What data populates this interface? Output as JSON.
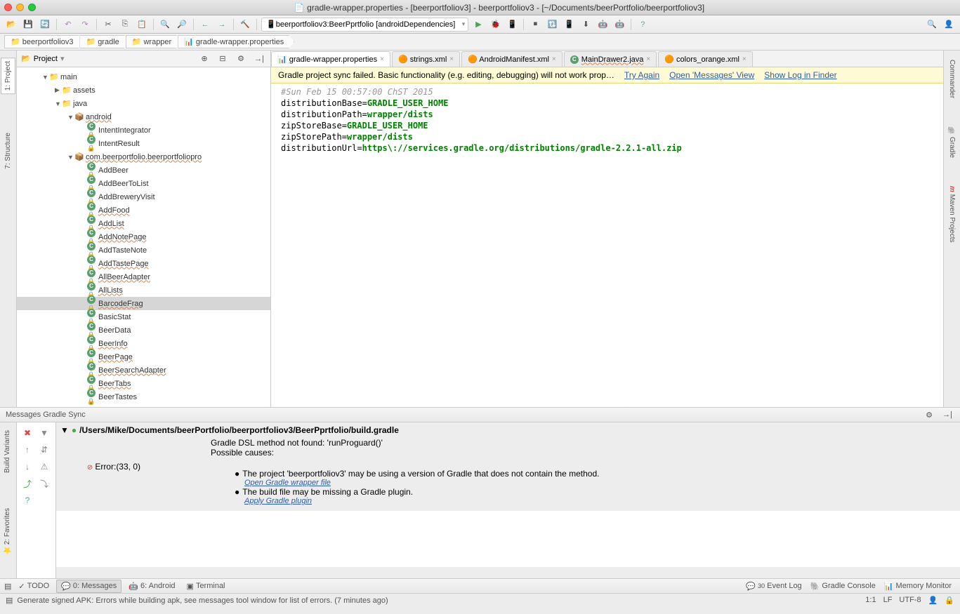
{
  "window": {
    "title": "gradle-wrapper.properties - [beerportfoliov3] - beerportfoliov3 - [~/Documents/beerPortfolio/beerportfoliov3]"
  },
  "toolbar": {
    "run_config": "beerportfoliov3:BeerPprtfolio [androidDependencies]"
  },
  "breadcrumbs": [
    "beerportfoliov3",
    "gradle",
    "wrapper",
    "gradle-wrapper.properties"
  ],
  "left_tabs": [
    "1: Project",
    "7: Structure"
  ],
  "right_tabs": [
    "Commander",
    "Gradle",
    "Maven Projects"
  ],
  "project_panel": {
    "title": "Project",
    "tree": [
      {
        "depth": 0,
        "arrow": "▼",
        "icon": "folder",
        "label": "main"
      },
      {
        "depth": 1,
        "arrow": "▶",
        "icon": "folder",
        "label": "assets"
      },
      {
        "depth": 1,
        "arrow": "▼",
        "icon": "folder",
        "label": "java"
      },
      {
        "depth": 2,
        "arrow": "▼",
        "icon": "pkg",
        "label": "android",
        "wavy": true
      },
      {
        "depth": 3,
        "arrow": "",
        "icon": "class",
        "label": "IntentIntegrator",
        "lock": true
      },
      {
        "depth": 3,
        "arrow": "",
        "icon": "class",
        "label": "IntentResult",
        "lock": true
      },
      {
        "depth": 2,
        "arrow": "▼",
        "icon": "pkg",
        "label": "com.beerportfolio.beerportfoliopro",
        "wavy": true
      },
      {
        "depth": 3,
        "arrow": "",
        "icon": "class",
        "label": "AddBeer",
        "lock": true
      },
      {
        "depth": 3,
        "arrow": "",
        "icon": "class",
        "label": "AddBeerToList",
        "lock": true
      },
      {
        "depth": 3,
        "arrow": "",
        "icon": "class",
        "label": "AddBreweryVisit",
        "lock": true
      },
      {
        "depth": 3,
        "arrow": "",
        "icon": "class",
        "label": "AddFood",
        "lock": true,
        "wavy": true
      },
      {
        "depth": 3,
        "arrow": "",
        "icon": "class",
        "label": "AddList",
        "lock": true,
        "wavy": true
      },
      {
        "depth": 3,
        "arrow": "",
        "icon": "class",
        "label": "AddNotePage",
        "lock": true,
        "wavy": true
      },
      {
        "depth": 3,
        "arrow": "",
        "icon": "class",
        "label": "AddTasteNote",
        "lock": true
      },
      {
        "depth": 3,
        "arrow": "",
        "icon": "class",
        "label": "AddTastePage",
        "lock": true,
        "wavy": true
      },
      {
        "depth": 3,
        "arrow": "",
        "icon": "class",
        "label": "AllBeerAdapter",
        "lock": true,
        "wavy": true
      },
      {
        "depth": 3,
        "arrow": "",
        "icon": "class",
        "label": "AllLists",
        "lock": true,
        "wavy": true
      },
      {
        "depth": 3,
        "arrow": "",
        "icon": "class",
        "label": "BarcodeFrag",
        "lock": true,
        "wavy": true,
        "selected": true
      },
      {
        "depth": 3,
        "arrow": "",
        "icon": "class",
        "label": "BasicStat",
        "lock": true
      },
      {
        "depth": 3,
        "arrow": "",
        "icon": "class",
        "label": "BeerData",
        "lock": true
      },
      {
        "depth": 3,
        "arrow": "",
        "icon": "class",
        "label": "BeerInfo",
        "lock": true,
        "wavy": true
      },
      {
        "depth": 3,
        "arrow": "",
        "icon": "class",
        "label": "BeerPage",
        "lock": true,
        "wavy": true
      },
      {
        "depth": 3,
        "arrow": "",
        "icon": "class",
        "label": "BeerSearchAdapter",
        "lock": true,
        "wavy": true
      },
      {
        "depth": 3,
        "arrow": "",
        "icon": "class",
        "label": "BeerTabs",
        "lock": true,
        "wavy": true
      },
      {
        "depth": 3,
        "arrow": "",
        "icon": "class",
        "label": "BeerTastes",
        "lock": true
      }
    ]
  },
  "editor_tabs": [
    {
      "label": "gradle-wrapper.properties",
      "active": true,
      "icon": "props"
    },
    {
      "label": "strings.xml",
      "icon": "xml"
    },
    {
      "label": "AndroidManifest.xml",
      "icon": "xml"
    },
    {
      "label": "MainDrawer2.java",
      "icon": "java",
      "wavy": true
    },
    {
      "label": "colors_orange.xml",
      "icon": "xml"
    }
  ],
  "sync_bar": {
    "msg": "Gradle project sync failed. Basic functionality (e.g. editing, debugging) will not work prop…",
    "try_again": "Try Again",
    "open_msgs": "Open 'Messages' View",
    "show_log": "Show Log in Finder"
  },
  "editor": {
    "comment": "#Sun Feb 15 00:57:00 ChST 2015",
    "l1k": "distributionBase=",
    "l1v": "GRADLE_USER_HOME",
    "l2k": "distributionPath=",
    "l2v": "wrapper/dists",
    "l3k": "zipStoreBase=",
    "l3v": "GRADLE_USER_HOME",
    "l4k": "zipStorePath=",
    "l4v": "wrapper/dists",
    "l5k": "distributionUrl=",
    "l5v": "https\\://services.gradle.org/distributions/gradle-2.2.1-all.zip"
  },
  "messages": {
    "title": "Messages Gradle Sync",
    "path": "/Users/Mike/Documents/beerPortfolio/beerportfoliov3/BeerPprtfolio/build.gradle",
    "line1": "Gradle DSL method not found: 'runProguard()'",
    "line2": "Possible causes:",
    "error_label": "Error:(33, 0)",
    "b1": "The project 'beerportfoliov3' may be using a version of Gradle that does not contain the method.",
    "b1link": "Open Gradle wrapper file",
    "b2": "The build file may be missing a Gradle plugin.",
    "b2link": "Apply Gradle plugin"
  },
  "bottom_tabs": {
    "todo": "TODO",
    "messages": "0: Messages",
    "android": "6: Android",
    "terminal": "Terminal",
    "event_log": "Event Log",
    "event_count": "30",
    "gradle_console": "Gradle Console",
    "memory": "Memory Monitor"
  },
  "status": {
    "msg": "Generate signed APK: Errors while building apk, see messages tool window for list of errors. (7 minutes ago)",
    "pos": "1:1",
    "lf": "LF",
    "enc": "UTF-8"
  },
  "side_left2": [
    "Build Variants",
    "2: Favorites"
  ]
}
